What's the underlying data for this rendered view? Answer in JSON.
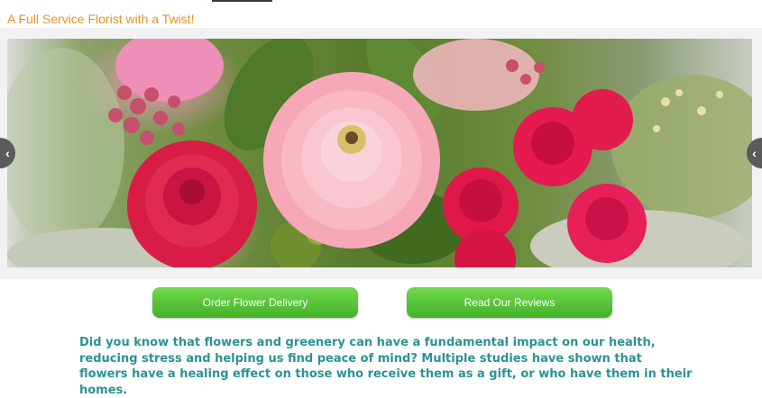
{
  "header": {
    "tagline": "A Full Service Florist with a Twist!"
  },
  "slider": {
    "prev_icon": "chevron-left-icon",
    "next_icon": "chevron-left-icon",
    "image_subject": "bouquet-of-pink-ranunculus-and-red-roses"
  },
  "buttons": {
    "order_label": "Order Flower Delivery",
    "reviews_label": "Read Our Reviews"
  },
  "intro": {
    "text": "Did you know that flowers and greenery can have a fundamental impact on our health, reducing stress and helping us find peace of mind?  Multiple studies have shown that flowers have a healing effect on those who receive them as a gift, or who have them in their homes."
  },
  "colors": {
    "tagline": "#e8922a",
    "button": "#4fbf30",
    "intro_text": "#2a9297",
    "arrow": "#5b5b5b"
  }
}
